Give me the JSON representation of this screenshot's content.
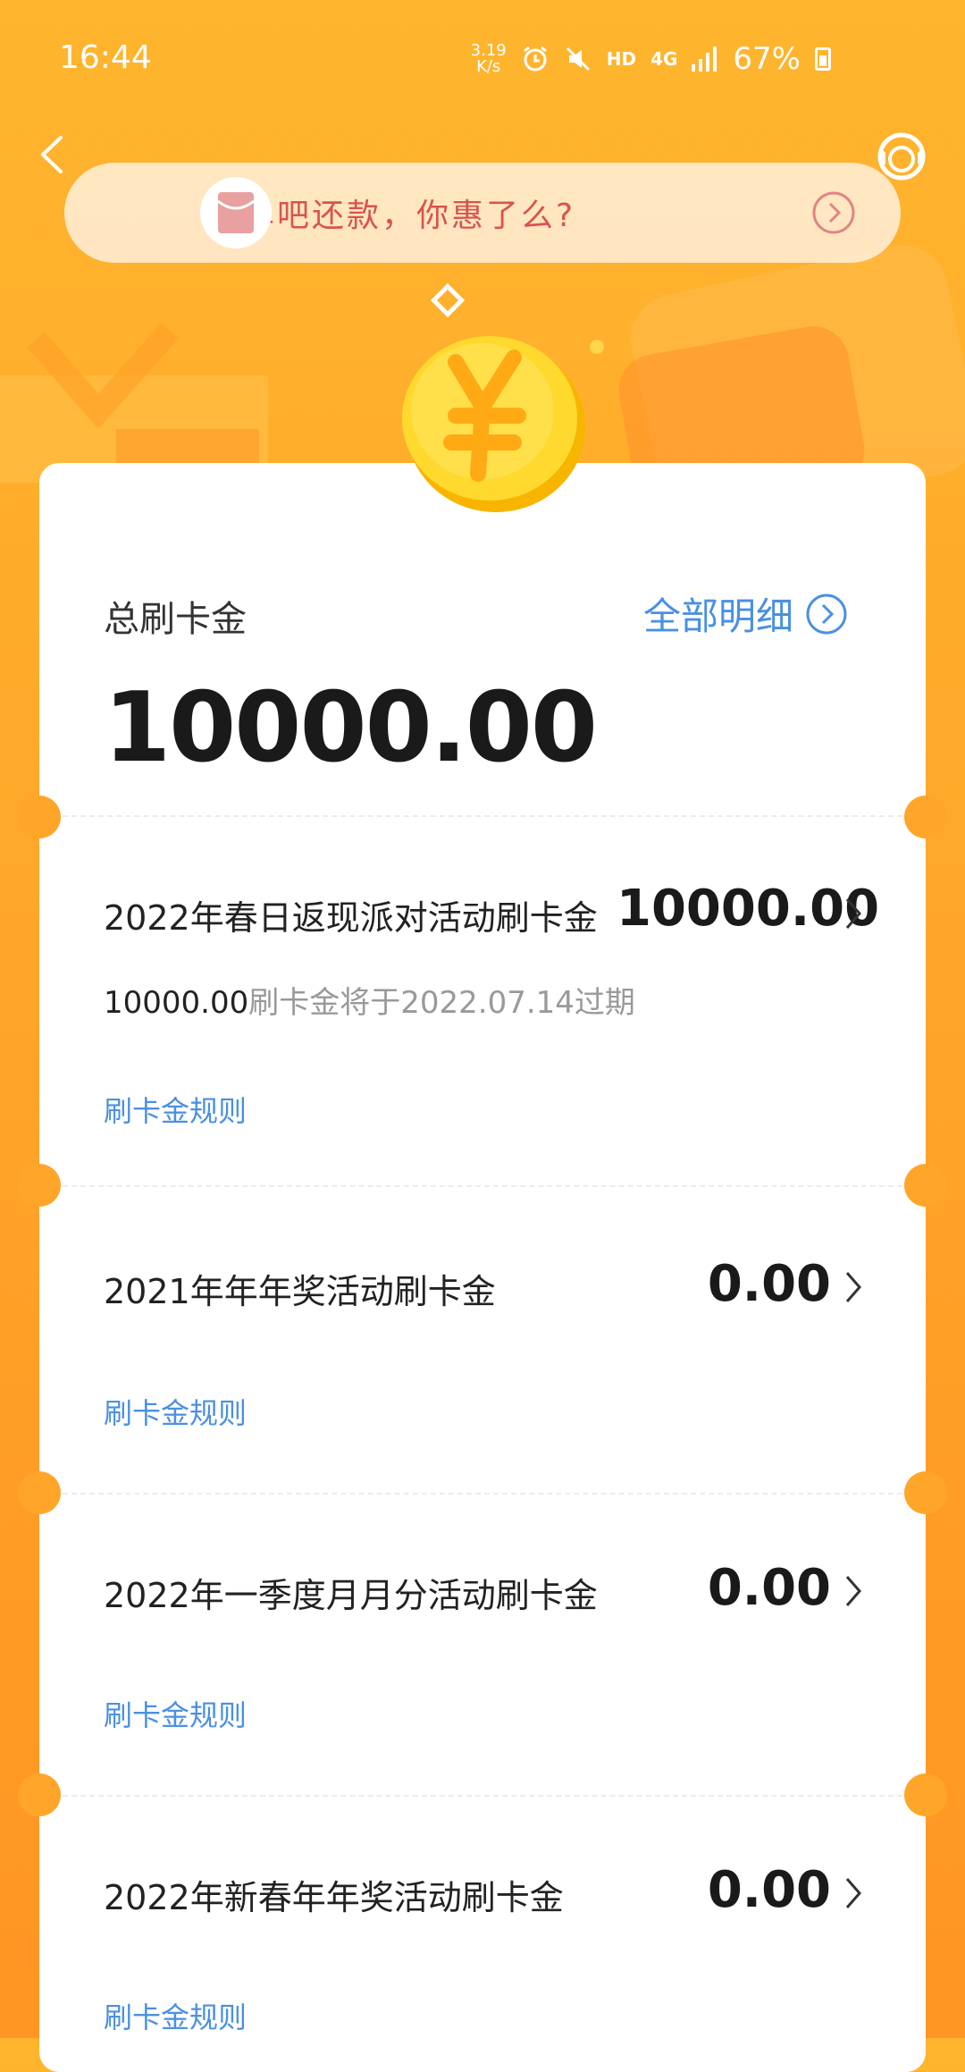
{
  "status": {
    "time": "16:44",
    "speed_top": "3.19",
    "speed_bottom": "K/s",
    "hd": "HD",
    "net": "4G",
    "battery": "67%"
  },
  "banner": {
    "text": "买单吧还款，你惠了么?"
  },
  "summary": {
    "label": "总刷卡金",
    "detail_link": "全部明细",
    "total": "10000.00"
  },
  "items": [
    {
      "title": "2022年春日返现派对活动刷卡金",
      "amount": "10000.00",
      "sub_amount": "10000.00",
      "sub_text": "刷卡金将于2022.07.14过期",
      "rule": "刷卡金规则"
    },
    {
      "title": "2021年年年奖活动刷卡金",
      "amount": "0.00",
      "rule": "刷卡金规则"
    },
    {
      "title": "2022年一季度月月分活动刷卡金",
      "amount": "0.00",
      "rule": "刷卡金规则"
    },
    {
      "title": "2022年新春年年奖活动刷卡金",
      "amount": "0.00",
      "rule": "刷卡金规则"
    }
  ],
  "colors": {
    "accent_blue": "#4A90E2",
    "background_orange": "#FFAA2A",
    "banner_text": "#D9534F"
  }
}
